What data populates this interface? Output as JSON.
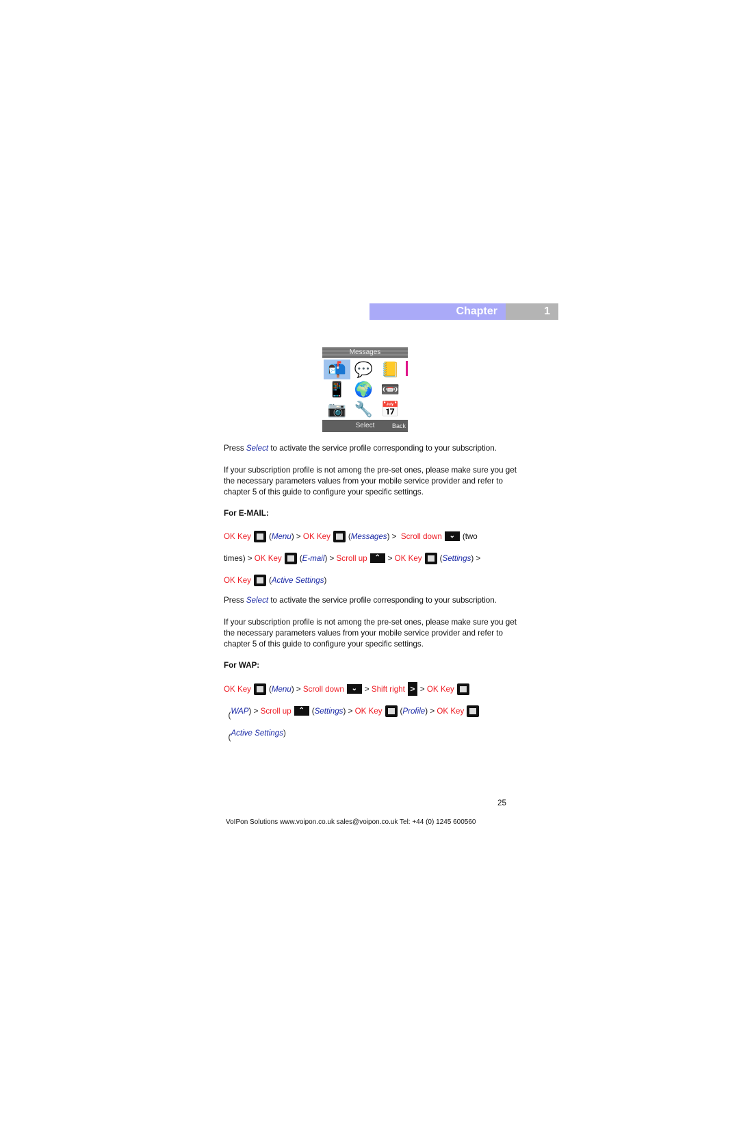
{
  "chapter": {
    "label": "Chapter",
    "number": "1"
  },
  "phone_screen": {
    "title": "Messages",
    "icons": [
      "mailbox-icon",
      "sms-icon",
      "book-icon",
      "phone-tower-icon",
      "globe-icon",
      "cassette-icon",
      "camera-icon",
      "phone-tools-icon",
      "calendar-icon"
    ],
    "softkey_select": "Select",
    "softkey_back": "Back"
  },
  "intro": {
    "press": "Press ",
    "select": "Select",
    "press_rest": " to activate the service profile corresponding to your subscription.",
    "note": "If your subscription profile is not among the pre-set ones, please make sure you get the necessary parameters values from your mobile service provider and refer to chapter 5 of this guide to configure your specific settings."
  },
  "email": {
    "heading": "For E-MAIL:",
    "ok_key": "OK Key",
    "menu": "Menu",
    "messages": "Messages",
    "scroll_down": "Scroll down",
    "two": "(two",
    "times": "times) > ",
    "email": "E-mail",
    "scroll_up": "Scroll up",
    "settings": "Settings",
    "active_settings": "Active Settings"
  },
  "second_intro": {
    "press": "Press ",
    "select": "Select",
    "press_rest": " to activate the service profile corresponding to your subscription.",
    "note": "If your subscription profile is not among the pre-set ones, please make sure you get the necessary parameters values from your mobile service provider and refer to chapter 5 of this guide to configure your specific settings."
  },
  "wap": {
    "heading": "For WAP:",
    "ok_key": "OK Key",
    "menu": "Menu",
    "scroll_down": "Scroll down",
    "shift_right": "Shift right",
    "wap": "WAP",
    "scroll_up": "Scroll up",
    "settings": "Settings",
    "profile": "Profile",
    "active_settings": "Active Settings"
  },
  "page_number": "25",
  "footer": "VoIPon Solutions  www.voipon.co.uk  sales@voipon.co.uk  Tel: +44 (0) 1245 600560"
}
